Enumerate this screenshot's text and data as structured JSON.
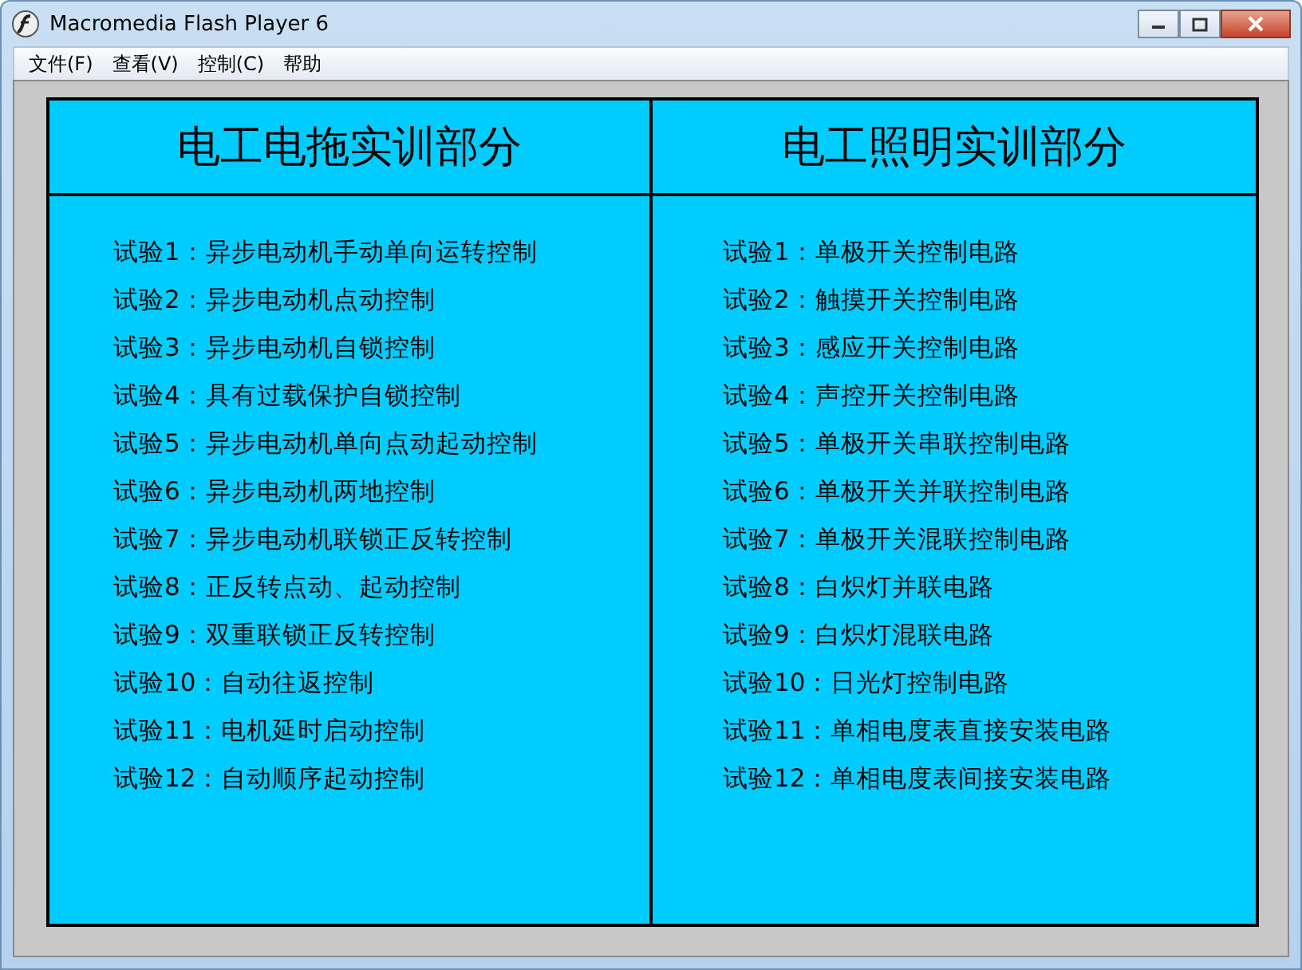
{
  "window": {
    "title": "Macromedia Flash Player 6"
  },
  "menu": [
    "文件(F)",
    "查看(V)",
    "控制(C)",
    "帮助"
  ],
  "panels": [
    {
      "title": "电工电拖实训部分",
      "items": [
        "试验1：异步电动机手动单向运转控制",
        "试验2：异步电动机点动控制",
        "试验3：异步电动机自锁控制",
        "试验4：具有过载保护自锁控制",
        "试验5：异步电动机单向点动起动控制",
        "试验6：异步电动机两地控制",
        "试验7：异步电动机联锁正反转控制",
        "试验8：正反转点动、起动控制",
        "试验9：双重联锁正反转控制",
        "试验10：自动往返控制",
        "试验11：电机延时启动控制",
        "试验12：自动顺序起动控制"
      ]
    },
    {
      "title": "电工照明实训部分",
      "items": [
        "试验1：单极开关控制电路",
        "试验2：触摸开关控制电路",
        "试验3：感应开关控制电路",
        "试验4：声控开关控制电路",
        "试验5：单极开关串联控制电路",
        "试验6：单极开关并联控制电路",
        "试验7：单极开关混联控制电路",
        "试验8：白炽灯并联电路",
        "试验9：白炽灯混联电路",
        "试验10：日光灯控制电路",
        "试验11：单相电度表直接安装电路",
        "试验12：单相电度表间接安装电路"
      ]
    }
  ]
}
